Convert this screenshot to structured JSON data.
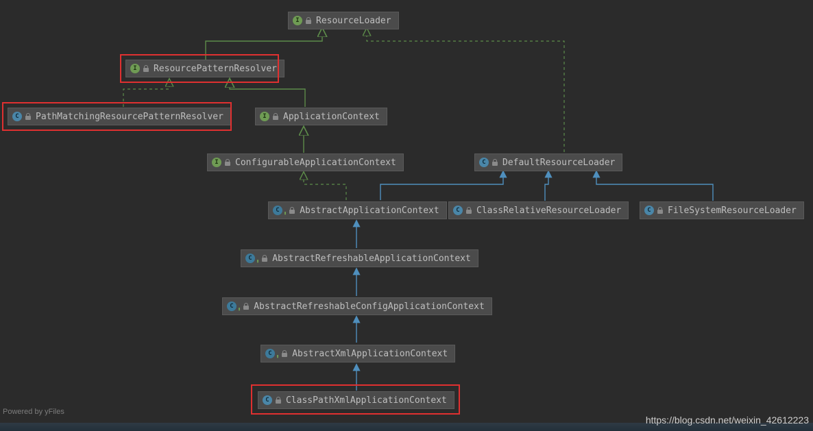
{
  "diagram": {
    "nodes": {
      "resourceLoader": {
        "label": "ResourceLoader",
        "kind": "interface"
      },
      "resourcePatternResolver": {
        "label": "ResourcePatternResolver",
        "kind": "interface"
      },
      "pathMatchingResourcePatternResolver": {
        "label": "PathMatchingResourcePatternResolver",
        "kind": "class"
      },
      "applicationContext": {
        "label": "ApplicationContext",
        "kind": "interface"
      },
      "configurableApplicationContext": {
        "label": "ConfigurableApplicationContext",
        "kind": "interface"
      },
      "defaultResourceLoader": {
        "label": "DefaultResourceLoader",
        "kind": "class"
      },
      "abstractApplicationContext": {
        "label": "AbstractApplicationContext",
        "kind": "abstract"
      },
      "classRelativeResourceLoader": {
        "label": "ClassRelativeResourceLoader",
        "kind": "class"
      },
      "fileSystemResourceLoader": {
        "label": "FileSystemResourceLoader",
        "kind": "class"
      },
      "abstractRefreshableApplicationContext": {
        "label": "AbstractRefreshableApplicationContext",
        "kind": "abstract"
      },
      "abstractRefreshableConfigApplicationContext": {
        "label": "AbstractRefreshableConfigApplicationContext",
        "kind": "abstract"
      },
      "abstractXmlApplicationContext": {
        "label": "AbstractXmlApplicationContext",
        "kind": "abstract"
      },
      "classPathXmlApplicationContext": {
        "label": "ClassPathXmlApplicationContext",
        "kind": "class"
      }
    }
  },
  "watermarks": {
    "bottomLeft": "Powered by yFiles",
    "bottomRight": "https://blog.csdn.net/weixin_42612223"
  }
}
